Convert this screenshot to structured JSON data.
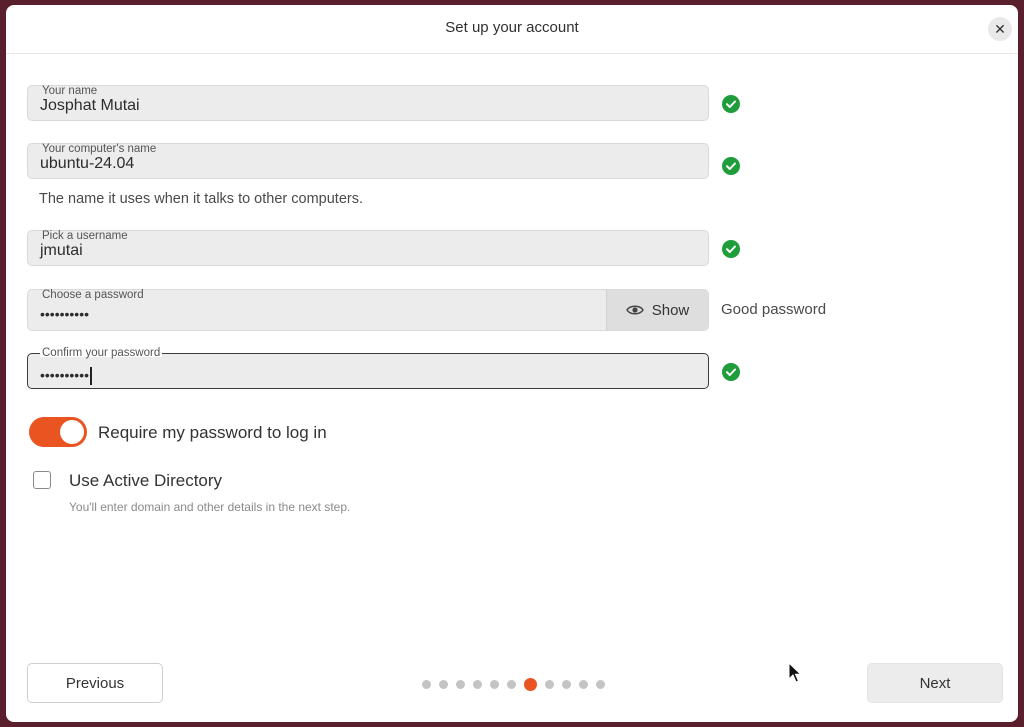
{
  "window": {
    "title": "Set up your account",
    "close_label": "✕"
  },
  "fields": {
    "name": {
      "label": "Your name",
      "value": "Josphat Mutai"
    },
    "computer": {
      "label": "Your computer's name",
      "value": "ubuntu-24.04",
      "hint": "The name it uses when it talks to other computers."
    },
    "username": {
      "label": "Pick a username",
      "value": "jmutai"
    },
    "password": {
      "label": "Choose a password",
      "value": "••••••••••",
      "show_label": "Show",
      "strength": "Good password"
    },
    "confirm": {
      "label": "Confirm your password",
      "value": "••••••••••"
    }
  },
  "options": {
    "require_password": {
      "label": "Require my password to log in",
      "enabled": true
    },
    "active_directory": {
      "label": "Use Active Directory",
      "hint": "You'll enter domain and other details in the next step.",
      "checked": false
    }
  },
  "footer": {
    "previous_label": "Previous",
    "next_label": "Next",
    "progress": {
      "total_steps": 11,
      "current_step": 7
    }
  },
  "colors": {
    "accent": "#e95420",
    "valid": "#1e9d3a"
  }
}
